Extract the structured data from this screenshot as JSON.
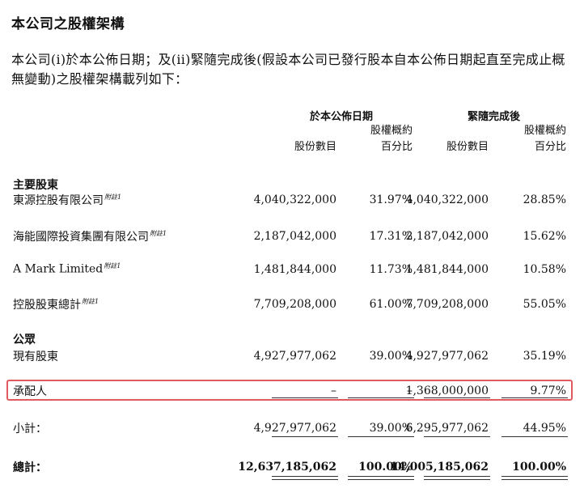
{
  "title": "本公司之股權架構",
  "intro": "本公司(i)於本公佈日期；及(ii)緊隨完成後(假設本公司已發行股本自本公佈日期起直至完成止概無變動)之股權架構載列如下：",
  "headers": {
    "period1": "於本公佈日期",
    "period2": "緊隨完成後",
    "shares": "股份數目",
    "pct_line1": "股權概約",
    "pct_line2": "百分比"
  },
  "sections": {
    "major": "主要股東",
    "public": "公眾"
  },
  "note_label": "附註1",
  "rows": [
    {
      "label": "東源控股有限公司",
      "shares1": "4,040,322,000",
      "pct1": "31.97%",
      "shares2": "4,040,322,000",
      "pct2": "28.85%"
    },
    {
      "label": "海能國際投資集團有限公司",
      "shares1": "2,187,042,000",
      "pct1": "17.31%",
      "shares2": "2,187,042,000",
      "pct2": "15.62%"
    },
    {
      "label": "A Mark Limited",
      "shares1": "1,481,844,000",
      "pct1": "11.73%",
      "shares2": "1,481,844,000",
      "pct2": "10.58%"
    },
    {
      "label": "控股股東總計",
      "shares1": "7,709,208,000",
      "pct1": "61.00%",
      "shares2": "7,709,208,000",
      "pct2": "55.05%"
    },
    {
      "label": "現有股東",
      "shares1": "4,927,977,062",
      "pct1": "39.00%",
      "shares2": "4,927,977,062",
      "pct2": "35.19%"
    },
    {
      "label": "承配人",
      "shares1": "–",
      "pct1": "–",
      "shares2": "1,368,000,000",
      "pct2": "9.77%"
    },
    {
      "label": "小計：",
      "shares1": "4,927,977,062",
      "pct1": "39.00%",
      "shares2": "6,295,977,062",
      "pct2": "44.95%"
    },
    {
      "label": "總計：",
      "shares1": "12,637,185,062",
      "pct1": "100.00%",
      "shares2": "14,005,185,062",
      "pct2": "100.00%"
    }
  ]
}
